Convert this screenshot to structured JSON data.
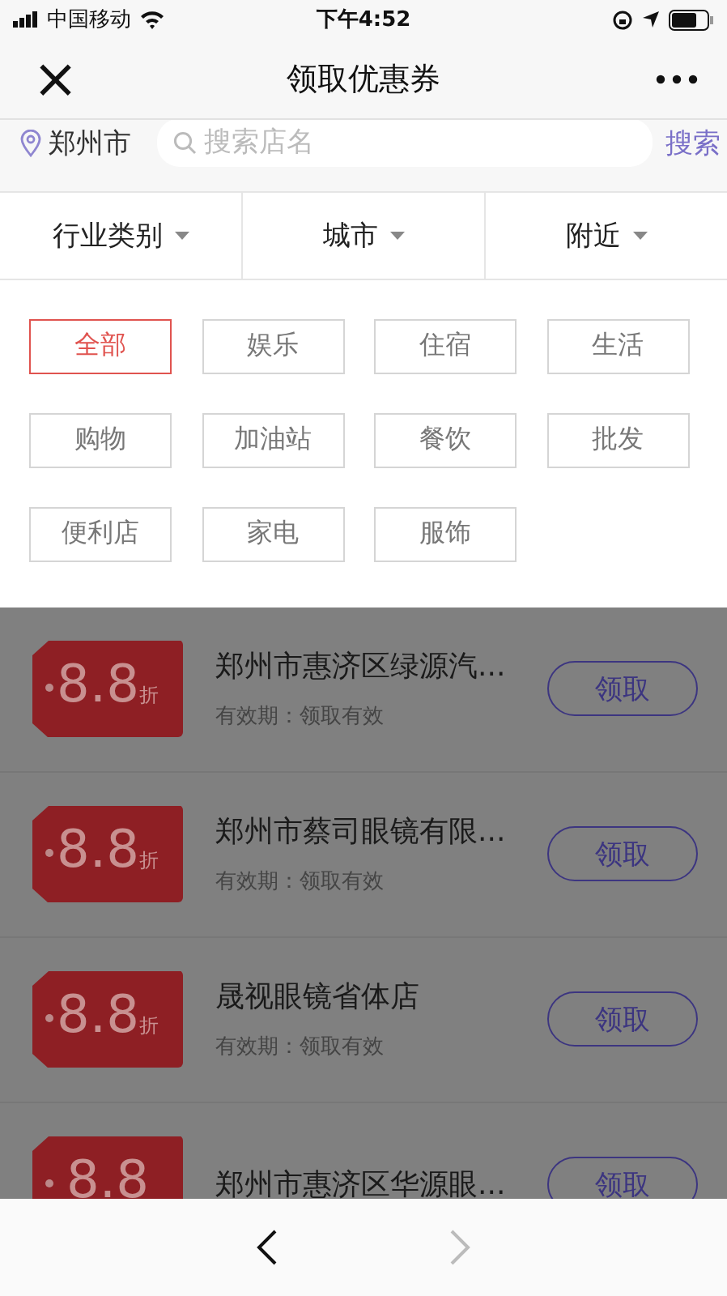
{
  "status_bar": {
    "carrier": "中国移动",
    "time": "下午4:52"
  },
  "nav": {
    "title": "领取优惠券",
    "close": "×"
  },
  "search": {
    "city": "郑州市",
    "placeholder": "搜索店名",
    "button": "搜索"
  },
  "filters": [
    {
      "label": "行业类别"
    },
    {
      "label": "城市"
    },
    {
      "label": "附近"
    }
  ],
  "categories": [
    {
      "label": "全部",
      "selected": true
    },
    {
      "label": "娱乐",
      "selected": false
    },
    {
      "label": "住宿",
      "selected": false
    },
    {
      "label": "生活",
      "selected": false
    },
    {
      "label": "购物",
      "selected": false
    },
    {
      "label": "加油站",
      "selected": false
    },
    {
      "label": "餐饮",
      "selected": false
    },
    {
      "label": "批发",
      "selected": false
    },
    {
      "label": "便利店",
      "selected": false
    },
    {
      "label": "家电",
      "selected": false
    },
    {
      "label": "服饰",
      "selected": false
    }
  ],
  "coupons": [
    {
      "discount": "8.8",
      "unit": "折",
      "name": "郑州市惠济区绿源汽...",
      "validity": "有效期：领取有效",
      "button": "领取"
    },
    {
      "discount": "8.8",
      "unit": "折",
      "name": "郑州市蔡司眼镜有限...",
      "validity": "有效期：领取有效",
      "button": "领取"
    },
    {
      "discount": "8.8",
      "unit": "折",
      "name": "晟视眼镜省体店",
      "validity": "有效期：领取有效",
      "button": "领取"
    },
    {
      "discount": "8.8",
      "name": "郑州市惠济区华源眼...",
      "button": "领取"
    }
  ],
  "toolbar": {
    "back_disabled": false,
    "forward_disabled": true
  }
}
